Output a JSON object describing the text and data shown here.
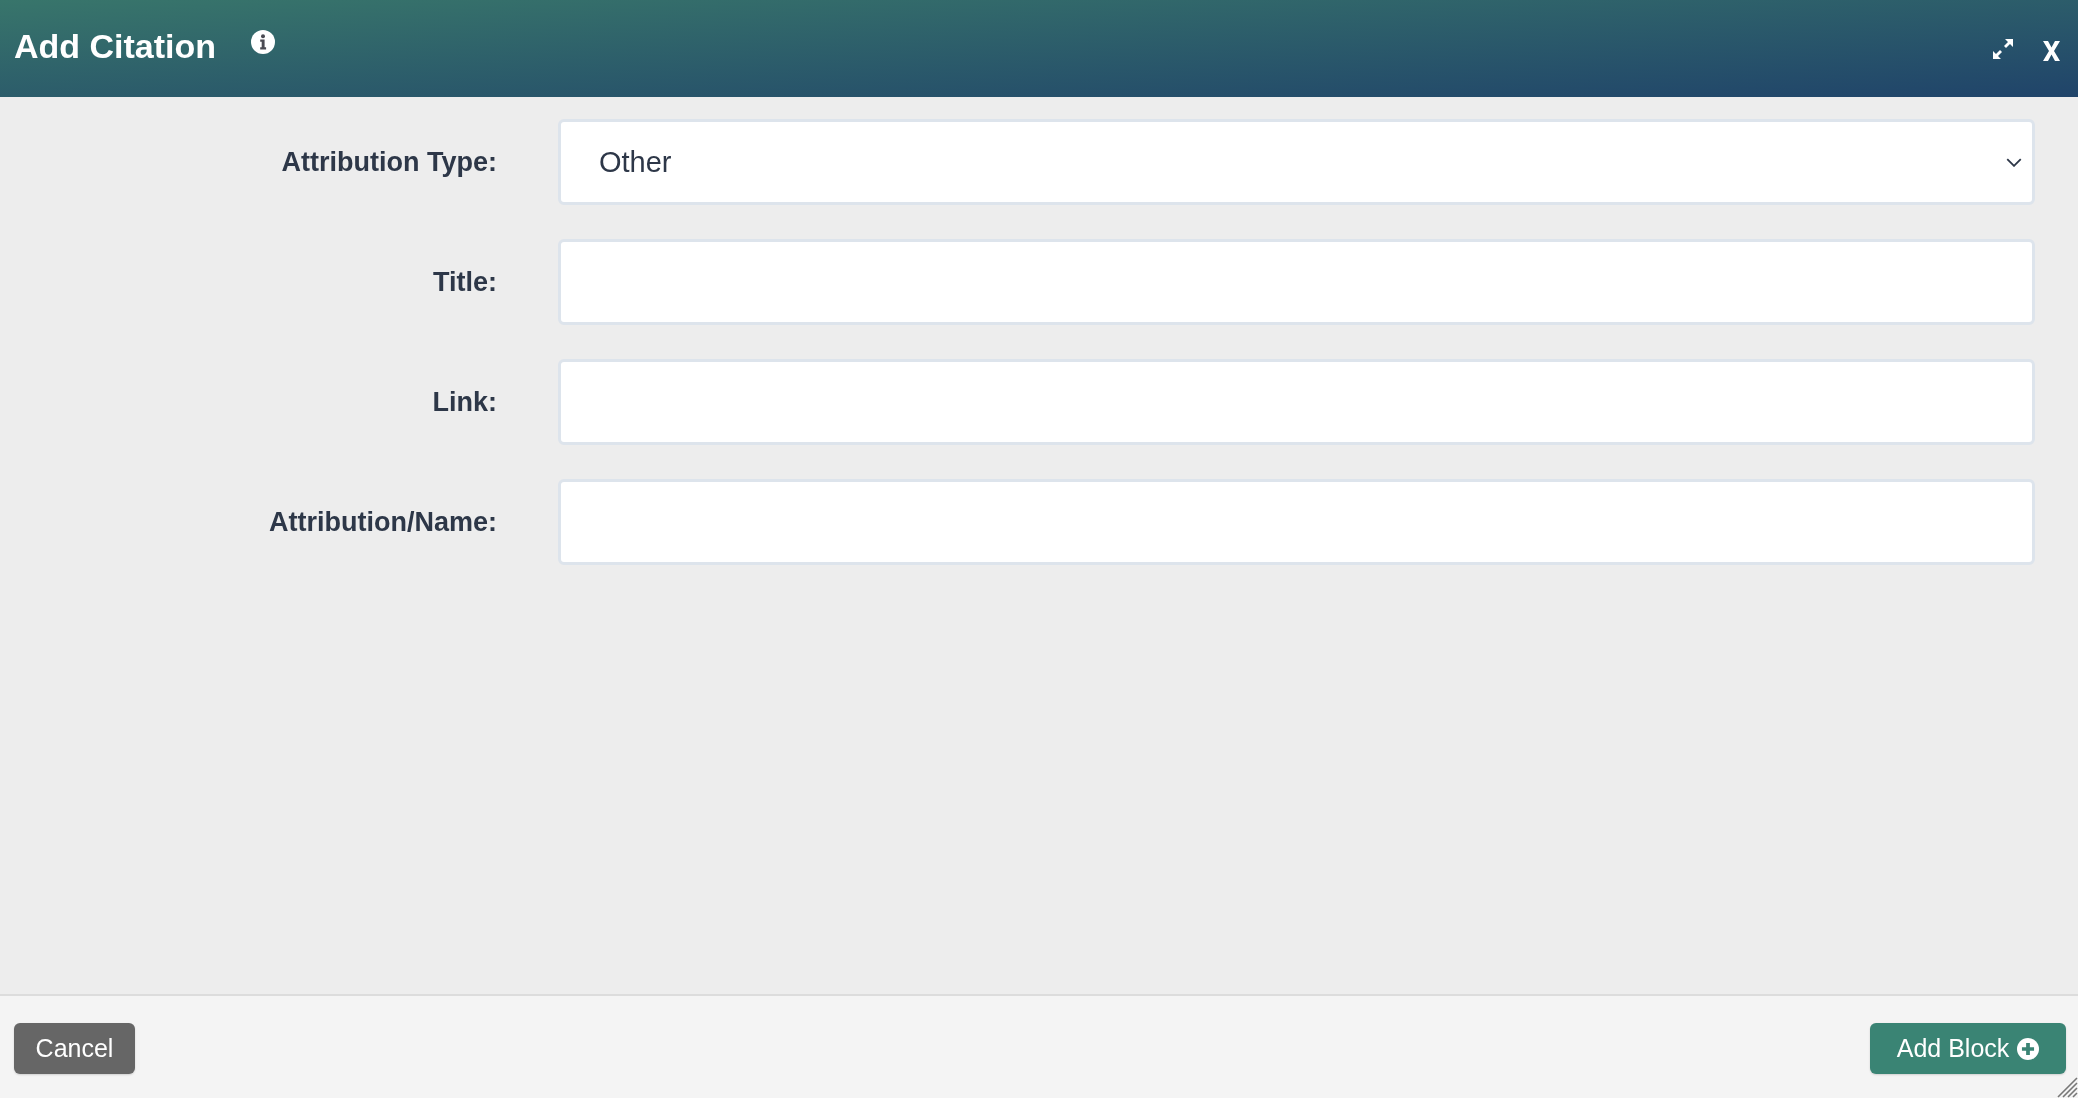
{
  "dialog": {
    "title": "Add Citation"
  },
  "fields": [
    {
      "kind": "select",
      "label": "Attribution Type:",
      "value": "Other"
    },
    {
      "kind": "text",
      "label": "Title:"
    },
    {
      "kind": "text",
      "label": "Link:"
    },
    {
      "kind": "text",
      "label": "Attribution/Name:"
    }
  ],
  "footer": {
    "buttons": [
      {
        "kind": "secondary",
        "label": "Cancel"
      },
      {
        "kind": "primary",
        "label": "Add Block"
      }
    ]
  }
}
